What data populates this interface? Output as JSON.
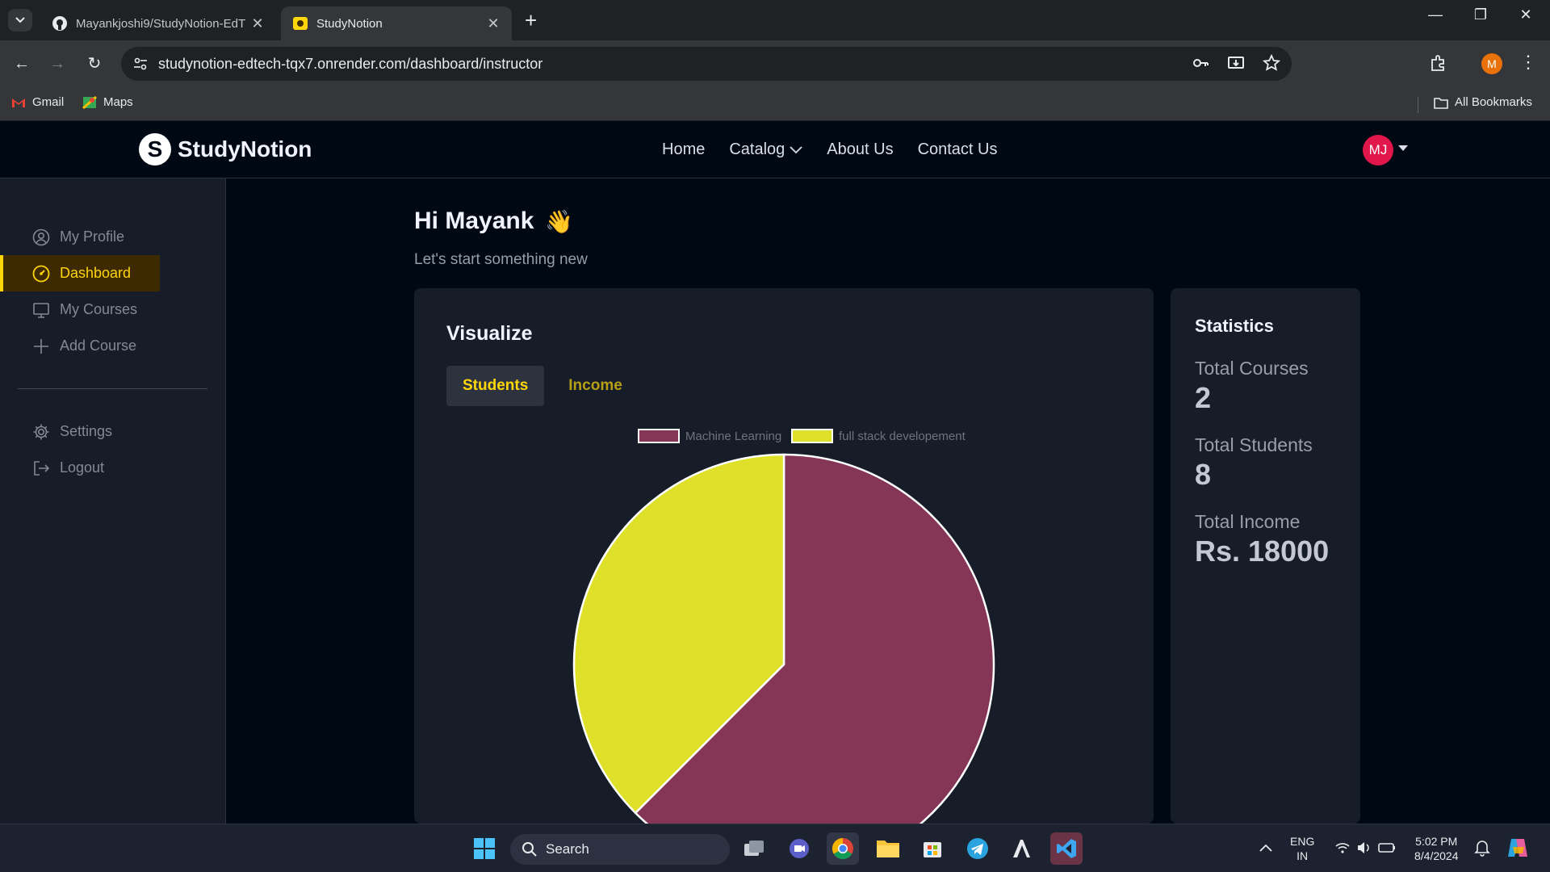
{
  "browser": {
    "tabs": [
      {
        "title": "Mayankjoshi9/StudyNotion-EdT",
        "icon": "github-icon"
      },
      {
        "title": "StudyNotion",
        "icon": "studynotion-favicon"
      }
    ],
    "url": "studynotion-edtech-tqx7.onrender.com/dashboard/instructor",
    "profile_initial": "M",
    "bookmarks": [
      "Gmail",
      "Maps"
    ],
    "all_bookmarks": "All Bookmarks"
  },
  "site": {
    "logo_text": "StudyNotion",
    "logo_mark": "S",
    "nav": [
      "Home",
      "Catalog",
      "About Us",
      "Contact Us"
    ],
    "avatar": "MJ"
  },
  "sidebar": {
    "items": [
      {
        "label": "My Profile",
        "icon": "user-circle-icon"
      },
      {
        "label": "Dashboard",
        "icon": "gauge-icon",
        "active": true
      },
      {
        "label": "My Courses",
        "icon": "monitor-icon"
      },
      {
        "label": "Add Course",
        "icon": "plus-icon"
      }
    ],
    "bottom": [
      {
        "label": "Settings",
        "icon": "gear-icon"
      },
      {
        "label": "Logout",
        "icon": "logout-icon"
      }
    ]
  },
  "main": {
    "greeting": "Hi Mayank",
    "greeting_emoji": "👋",
    "subtitle": "Let's start something new",
    "visualize": {
      "title": "Visualize",
      "tabs": [
        "Students",
        "Income"
      ],
      "active_tab": "Students"
    },
    "statistics": {
      "title": "Statistics",
      "items": [
        {
          "label": "Total Courses",
          "value": "2"
        },
        {
          "label": "Total Students",
          "value": "8"
        },
        {
          "label": "Total Income",
          "value": "Rs. 18000"
        }
      ]
    }
  },
  "chart_data": {
    "type": "pie",
    "series": [
      {
        "name": "Machine Learning",
        "value": 5,
        "color": "#853656"
      },
      {
        "name": "full stack developement",
        "value": 3,
        "color": "#dfe02a"
      }
    ],
    "legend": "top"
  },
  "taskbar": {
    "search_label": "Search",
    "lang": "ENG",
    "region": "IN",
    "time": "5:02 PM",
    "date": "8/4/2024"
  }
}
